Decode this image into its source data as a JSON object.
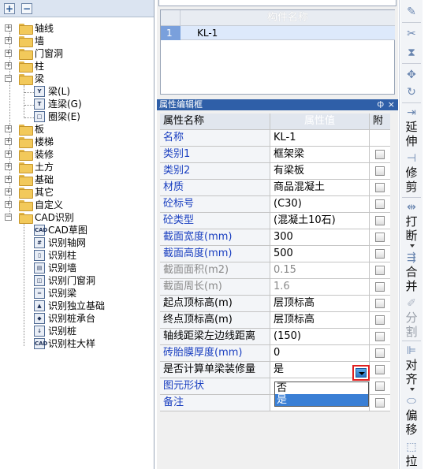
{
  "tree": {
    "toolbar": {
      "expand_label": "+",
      "collapse_label": "−"
    },
    "items": [
      {
        "label": "轴线",
        "state": "+"
      },
      {
        "label": "墙",
        "state": "+"
      },
      {
        "label": "门窗洞",
        "state": "+"
      },
      {
        "label": "柱",
        "state": "+"
      },
      {
        "label": "梁",
        "state": "−"
      },
      {
        "label": "板",
        "state": "+"
      },
      {
        "label": "楼梯",
        "state": "+"
      },
      {
        "label": "装修",
        "state": "+"
      },
      {
        "label": "土方",
        "state": "+"
      },
      {
        "label": "基础",
        "state": "+"
      },
      {
        "label": "其它",
        "state": "+"
      },
      {
        "label": "自定义",
        "state": "+"
      },
      {
        "label": "CAD识别",
        "state": "−"
      }
    ],
    "beam_children": [
      {
        "label": "梁(L)",
        "icon": "beam-icon"
      },
      {
        "label": "连梁(G)",
        "icon": "link-beam-icon"
      },
      {
        "label": "圈梁(E)",
        "icon": "ring-beam-icon"
      }
    ],
    "cad_children": [
      {
        "label": "CAD草图",
        "icon": "cad-sketch-icon",
        "icon_text": "CAD"
      },
      {
        "label": "识别轴网",
        "icon": "recognize-grid-icon",
        "icon_text": ""
      },
      {
        "label": "识别柱",
        "icon": "recognize-column-icon",
        "icon_text": ""
      },
      {
        "label": "识别墙",
        "icon": "recognize-wall-icon",
        "icon_text": ""
      },
      {
        "label": "识别门窗洞",
        "icon": "recognize-opening-icon",
        "icon_text": ""
      },
      {
        "label": "识别梁",
        "icon": "recognize-beam-icon",
        "icon_text": ""
      },
      {
        "label": "识别独立基础",
        "icon": "recognize-footing-icon",
        "icon_text": ""
      },
      {
        "label": "识别桩承台",
        "icon": "recognize-pilecap-icon",
        "icon_text": ""
      },
      {
        "label": "识别桩",
        "icon": "recognize-pile-icon",
        "icon_text": ""
      },
      {
        "label": "识别柱大样",
        "icon": "recognize-column-detail-icon",
        "icon_text": "CAD"
      }
    ]
  },
  "component_list": {
    "header": "构件名称",
    "rows": [
      {
        "num": "1",
        "name": "KL-1"
      }
    ]
  },
  "property_editor": {
    "title": "属性编辑框",
    "pin_glyph": "ф",
    "close_glyph": "×",
    "headers": {
      "name": "属性名称",
      "value": "属性值",
      "attach": "附"
    },
    "rows": [
      {
        "name": "名称",
        "value": "KL-1",
        "style": "blue",
        "checkbox": false
      },
      {
        "name": "类别1",
        "value": "框架梁",
        "style": "blue",
        "checkbox": true
      },
      {
        "name": "类别2",
        "value": "有梁板",
        "style": "blue",
        "checkbox": true
      },
      {
        "name": "材质",
        "value": "商品混凝土",
        "style": "blue",
        "checkbox": true
      },
      {
        "name": "砼标号",
        "value": "(C30)",
        "style": "blue",
        "checkbox": true
      },
      {
        "name": "砼类型",
        "value": "(混凝土10石)",
        "style": "blue",
        "checkbox": true
      },
      {
        "name": "截面宽度(mm)",
        "value": "300",
        "style": "blue",
        "checkbox": true
      },
      {
        "name": "截面高度(mm)",
        "value": "500",
        "style": "blue",
        "checkbox": true
      },
      {
        "name": "截面面积(m2)",
        "value": "0.15",
        "style": "gray",
        "checkbox": true
      },
      {
        "name": "截面周长(m)",
        "value": "1.6",
        "style": "gray",
        "checkbox": true
      },
      {
        "name": "起点顶标高(m)",
        "value": "层顶标高",
        "style": "black",
        "checkbox": true
      },
      {
        "name": "终点顶标高(m)",
        "value": "层顶标高",
        "style": "black",
        "checkbox": true
      },
      {
        "name": "轴线距梁左边线距离",
        "value": "(150)",
        "style": "black",
        "checkbox": true
      },
      {
        "name": "砖胎膜厚度(mm)",
        "value": "0",
        "style": "blue",
        "checkbox": true
      },
      {
        "name": "是否计算单梁装修量",
        "value": "是",
        "style": "black",
        "checkbox": true
      },
      {
        "name": "图元形状",
        "value": "",
        "style": "blue",
        "checkbox": true
      },
      {
        "name": "备注",
        "value": "",
        "style": "blue",
        "checkbox": true
      }
    ],
    "dropdown": {
      "options": [
        "否",
        "是"
      ],
      "selected": "是"
    }
  },
  "right_toolbar": {
    "labels": [
      "延伸",
      "修剪",
      "打断",
      "合并",
      "分割",
      "对齐",
      "偏移",
      "拉"
    ]
  }
}
